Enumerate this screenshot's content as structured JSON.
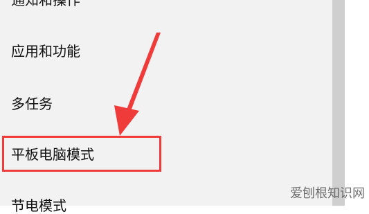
{
  "menu": {
    "items": [
      {
        "label": "通知和操作"
      },
      {
        "label": "应用和功能"
      },
      {
        "label": "多任务"
      },
      {
        "label": "平板电脑模式"
      },
      {
        "label": "节电模式"
      }
    ],
    "highlighted_index": 3
  },
  "annotation": {
    "arrow_color": "#f03b3b",
    "box_color": "#f03b3b"
  },
  "watermark": {
    "text": "爱刨根知识网"
  }
}
